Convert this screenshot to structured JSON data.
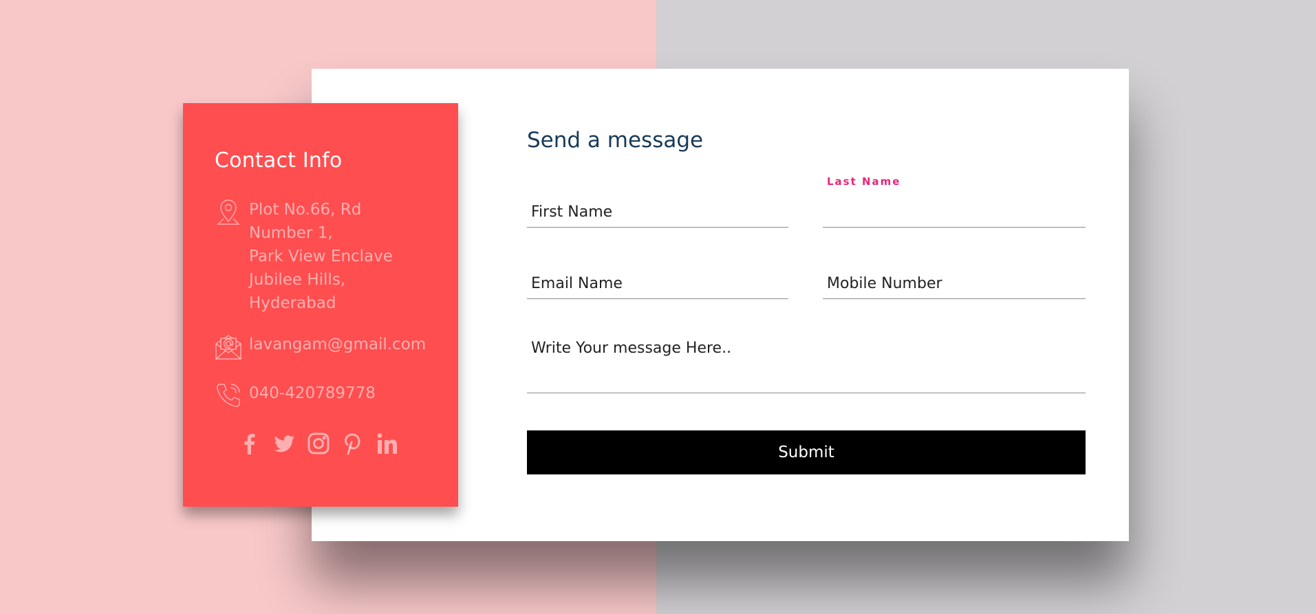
{
  "contact_info": {
    "title": "Contact Info",
    "address": "Plot No.66, Rd Number 1,\nPark View Enclave\nJubilee Hills,\nHyderabad",
    "email": "lavangam@gmail.com",
    "phone": "040-420789778",
    "icons": {
      "address": "location-pin-icon",
      "email": "envelope-at-icon",
      "phone": "phone-icon"
    },
    "socials": [
      "facebook-icon",
      "twitter-icon",
      "instagram-icon",
      "pinterest-icon",
      "linkedin-icon"
    ]
  },
  "form": {
    "title": "Send a message",
    "first_name_placeholder": "First Name",
    "last_name_label": "Last Name",
    "last_name_value": "",
    "email_placeholder": "Email Name",
    "mobile_placeholder": "Mobile Number",
    "message_placeholder": "Write Your message Here..",
    "submit_label": "Submit"
  },
  "colors": {
    "left_background": "#f8c8c9",
    "right_background": "#d2d0d3",
    "info_card": "#fe4e50",
    "form_title": "#173a59",
    "floating_label": "#e8267a",
    "submit_button": "#000000"
  }
}
